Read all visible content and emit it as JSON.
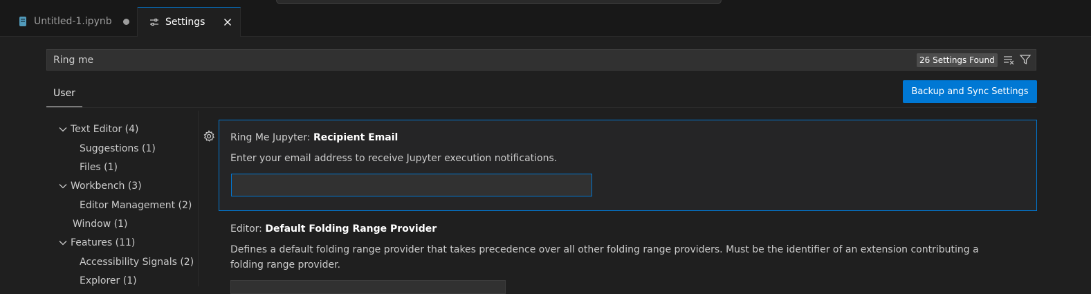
{
  "tabs": [
    {
      "label": "Untitled-1.ipynb",
      "icon": "notebook-icon",
      "dirty": true
    },
    {
      "label": "Settings",
      "icon": "settings-sliders-icon",
      "active": true
    }
  ],
  "search": {
    "value": "Ring me",
    "results_badge": "26 Settings Found"
  },
  "scope": {
    "user_tab": "User",
    "sync_button": "Backup and Sync Settings"
  },
  "toc": [
    {
      "label": "Text Editor (4)",
      "expanded": true
    },
    {
      "label": "Suggestions (1)"
    },
    {
      "label": "Files (1)"
    },
    {
      "label": "Workbench (3)",
      "expanded": true
    },
    {
      "label": "Editor Management (2)"
    },
    {
      "label": "Window (1)"
    },
    {
      "label": "Features (11)",
      "expanded": true
    },
    {
      "label": "Accessibility Signals (2)"
    },
    {
      "label": "Explorer (1)"
    }
  ],
  "settings": [
    {
      "category": "Ring Me Jupyter: ",
      "name": "Recipient Email",
      "description": "Enter your email address to receive Jupyter execution notifications.",
      "value": ""
    },
    {
      "category": "Editor: ",
      "name": "Default Folding Range Provider",
      "description_line1": "Defines a default folding range provider that takes precedence over all other folding range providers. Must be the identifier of an extension contributing a",
      "description_line2": "folding range provider."
    }
  ],
  "colors": {
    "accent": "#0078d4",
    "background": "#1f1f1f",
    "tabbar": "#181818"
  }
}
